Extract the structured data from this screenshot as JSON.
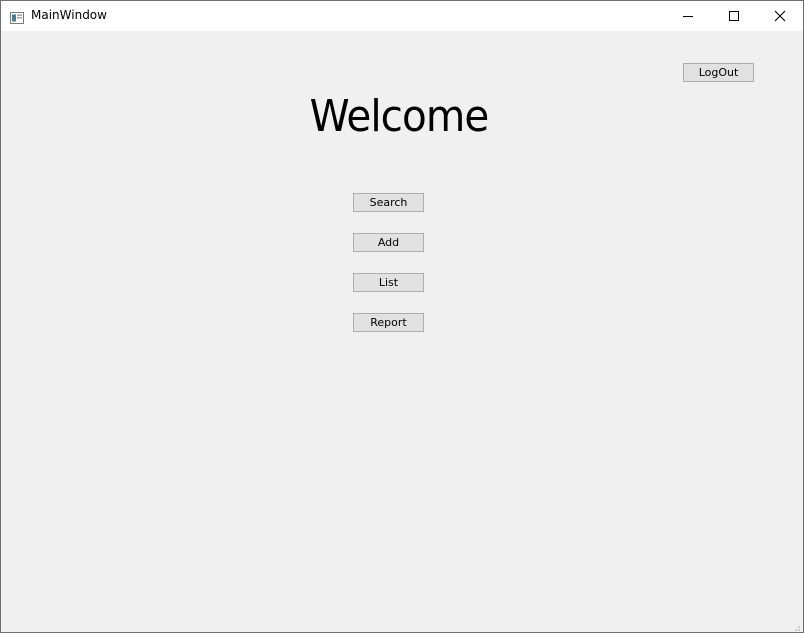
{
  "window": {
    "title": "MainWindow",
    "icon": "app-window-icon"
  },
  "title_controls": {
    "minimize_icon": "minimize-icon",
    "maximize_icon": "maximize-icon",
    "close_icon": "close-icon"
  },
  "main": {
    "heading": "Welcome",
    "logout_label": "LogOut",
    "buttons": [
      {
        "label": "Search"
      },
      {
        "label": "Add"
      },
      {
        "label": "List"
      },
      {
        "label": "Report"
      }
    ]
  },
  "colors": {
    "window_background": "#f0f0f0",
    "titlebar_background": "#ffffff",
    "button_background": "#e1e1e1",
    "button_border": "#adadad"
  }
}
